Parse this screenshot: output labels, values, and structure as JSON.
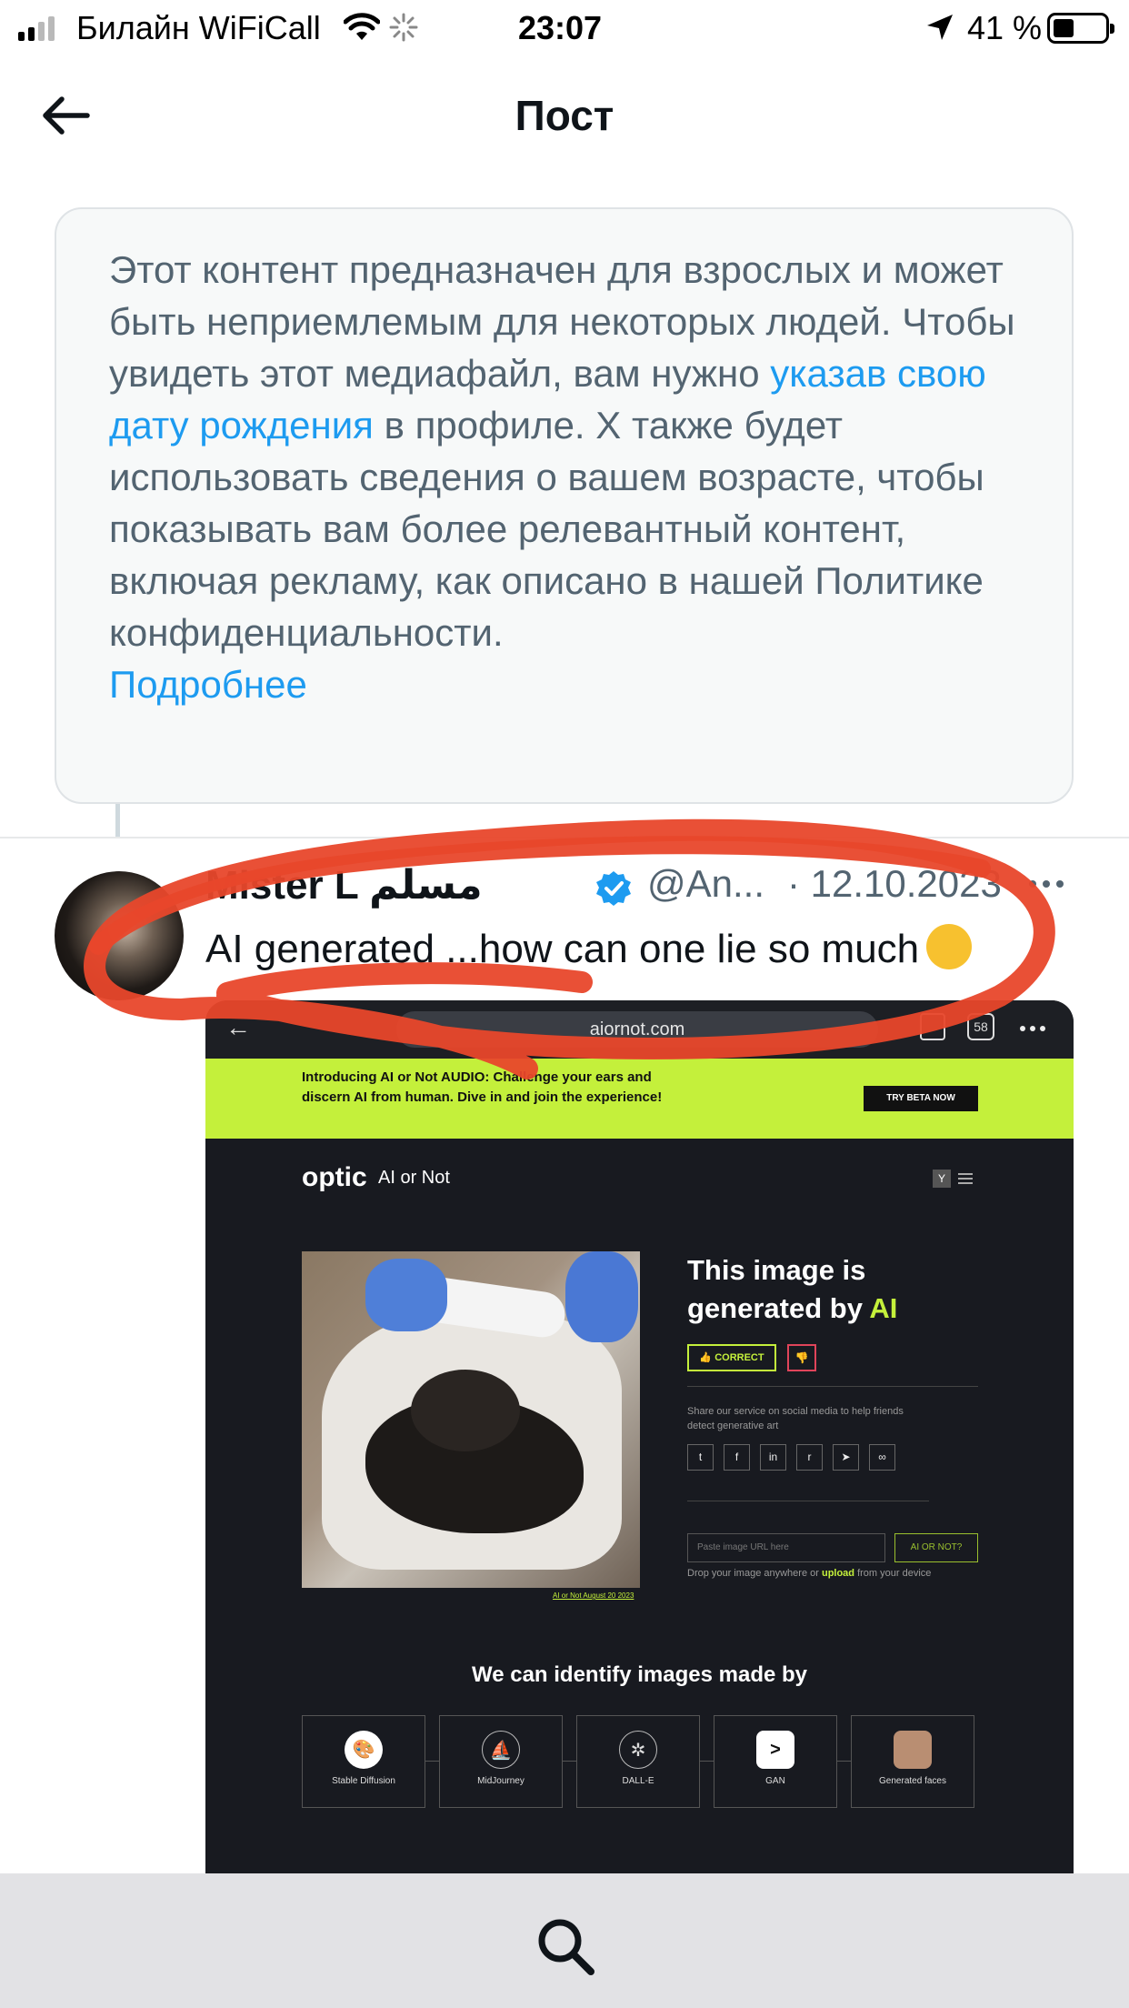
{
  "status_bar": {
    "carrier": "Билайн WiFiCall",
    "time": "23:07",
    "battery": "41 %",
    "battery_level": 0.41
  },
  "header": {
    "title": "Пост",
    "back_icon": "arrow-left-icon"
  },
  "warning": {
    "text_before": "Этот контент предназначен для взрослых и может быть неприемлемым для некоторых людей. Чтобы увидеть этот медиафайл, вам нужно ",
    "link_birthdate": "указав свою дату рождения",
    "text_after": " в профиле. X также будет использовать сведения о вашем возрасте, чтобы показывать вам более релевантный контент, включая рекламу, как описано в нашей Политике конфиденциальности.",
    "learn_more": "Подробнее"
  },
  "tweet": {
    "author_name": "Mister L مسلم",
    "handle": "@An...",
    "date": "· 12.10.2023",
    "text": "AI generated ...how can one lie so much",
    "verified": true,
    "accent_color": "#1d9bf0"
  },
  "media": {
    "url": "aiornot.com",
    "tabs_count": "58",
    "banner_text": "Introducing AI or Not AUDIO: Challenge your ears and discern AI from human. Dive in and join the experience!",
    "banner_button": "TRY BETA NOW",
    "logo": "optic",
    "logo_sub": "AI or Not",
    "menu_badge": "Y",
    "result_title": "This image is generated by",
    "result_ai": "AI",
    "correct_label": "CORRECT",
    "share_text": "Share our service on social media to help friends detect generative art",
    "url_placeholder": "Paste image URL here",
    "check_button": "AI OR NOT?",
    "drop_text_before": "Drop your image anywhere or ",
    "drop_upload": "upload",
    "drop_text_after": " from your device",
    "photo_caption": "AI or Not August 20 2023",
    "identify_title": "We can identify images made by",
    "generators": [
      {
        "label": "Stable Diffusion",
        "icon": "palette-icon"
      },
      {
        "label": "MidJourney",
        "icon": "sailboat-icon"
      },
      {
        "label": "DALL-E",
        "icon": "openai-icon"
      },
      {
        "label": "GAN",
        "icon": "terminal-icon"
      },
      {
        "label": "Generated faces",
        "icon": "face-icon"
      }
    ],
    "brand_green": "#c4f03b"
  },
  "bottom_bar": {
    "search_icon": "search-icon"
  },
  "annotation_color": "#e8472b"
}
